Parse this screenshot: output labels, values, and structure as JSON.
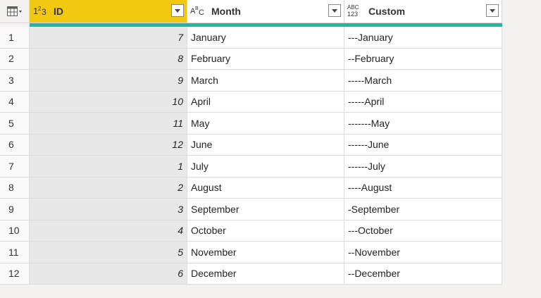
{
  "columns": [
    {
      "type_icon": "123",
      "label": "ID"
    },
    {
      "type_icon": "ABC",
      "label": "Month"
    },
    {
      "type_icon": "ABC/123",
      "label": "Custom"
    }
  ],
  "rows": [
    {
      "num": "1",
      "id": "7",
      "month": "January",
      "custom": "---January"
    },
    {
      "num": "2",
      "id": "8",
      "month": "February",
      "custom": "--February"
    },
    {
      "num": "3",
      "id": "9",
      "month": "March",
      "custom": "-----March"
    },
    {
      "num": "4",
      "id": "10",
      "month": "April",
      "custom": "-----April"
    },
    {
      "num": "5",
      "id": "11",
      "month": "May",
      "custom": "-------May"
    },
    {
      "num": "6",
      "id": "12",
      "month": "June",
      "custom": "------June"
    },
    {
      "num": "7",
      "id": "1",
      "month": "July",
      "custom": "------July"
    },
    {
      "num": "8",
      "id": "2",
      "month": "August",
      "custom": "----August"
    },
    {
      "num": "9",
      "id": "3",
      "month": "September",
      "custom": "-September"
    },
    {
      "num": "10",
      "id": "4",
      "month": "October",
      "custom": "---October"
    },
    {
      "num": "11",
      "id": "5",
      "month": "November",
      "custom": "--November"
    },
    {
      "num": "12",
      "id": "6",
      "month": "December",
      "custom": "--December"
    }
  ],
  "colors": {
    "selected_header": "#f2c811",
    "quality_bar": "#1fb79d"
  }
}
